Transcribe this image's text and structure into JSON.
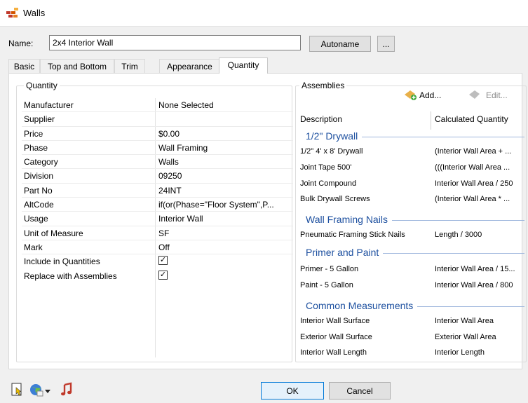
{
  "window": {
    "title": "Walls"
  },
  "name_field": {
    "label": "Name:",
    "value": "2x4 Interior Wall"
  },
  "buttons": {
    "autoname": "Autoname",
    "more": "...",
    "ok": "OK",
    "cancel": "Cancel"
  },
  "tabs": [
    "Basic",
    "Top and Bottom",
    "Trim",
    "Appearance",
    "Quantity"
  ],
  "active_tab": "Quantity",
  "quantity": {
    "group_title": "Quantity",
    "rows": [
      {
        "label": "Manufacturer",
        "value": "None Selected"
      },
      {
        "label": "Supplier",
        "value": ""
      },
      {
        "label": "Price",
        "value": "$0.00"
      },
      {
        "label": "Phase",
        "value": "Wall Framing"
      },
      {
        "label": "Category",
        "value": "Walls"
      },
      {
        "label": "Division",
        "value": "09250"
      },
      {
        "label": "Part No",
        "value": "24INT"
      },
      {
        "label": "AltCode",
        "value": "if(or(Phase=\"Floor System\",P..."
      },
      {
        "label": "Usage",
        "value": "Interior Wall"
      },
      {
        "label": "Unit of Measure",
        "value": "SF"
      },
      {
        "label": "Mark",
        "value": "Off"
      },
      {
        "label": "Include in Quantities",
        "checked": true
      },
      {
        "label": "Replace with Assemblies",
        "checked": true
      }
    ]
  },
  "assemblies": {
    "group_title": "Assemblies",
    "add_label": "Add...",
    "edit_label": "Edit...",
    "col_description": "Description",
    "col_quantity": "Calculated Quantity",
    "sections": [
      {
        "title": "1/2\" Drywall",
        "items": [
          {
            "desc": "1/2\" 4' x 8' Drywall",
            "qty": "(Interior Wall Area + ..."
          },
          {
            "desc": "Joint Tape 500'",
            "qty": "(((Interior Wall Area ..."
          },
          {
            "desc": "Joint Compound",
            "qty": "Interior Wall Area / 250"
          },
          {
            "desc": "Bulk Drywall Screws",
            "qty": "(Interior Wall Area * ..."
          }
        ]
      },
      {
        "title": "Wall Framing Nails",
        "items": [
          {
            "desc": "Pneumatic Framing Stick Nails",
            "qty": "Length / 3000"
          }
        ]
      },
      {
        "title": "Primer and Paint",
        "items": [
          {
            "desc": "Primer - 5 Gallon",
            "qty": "Interior Wall Area / 15..."
          },
          {
            "desc": "Paint - 5 Gallon",
            "qty": "Interior Wall Area / 800"
          }
        ]
      },
      {
        "title": "Common Measurements",
        "items": [
          {
            "desc": "Interior Wall Surface",
            "qty": "Interior Wall Area"
          },
          {
            "desc": "Exterior Wall Surface",
            "qty": "Exterior Wall Area"
          },
          {
            "desc": "Interior Wall Length",
            "qty": "Interior Length"
          }
        ]
      }
    ]
  },
  "colors": {
    "section_title": "#1c4f9f",
    "accent": "#0078d7"
  },
  "bottom_icons": [
    "document-select-icon",
    "globe-icon",
    "dropdown-arrow-icon",
    "music-note-icon"
  ]
}
